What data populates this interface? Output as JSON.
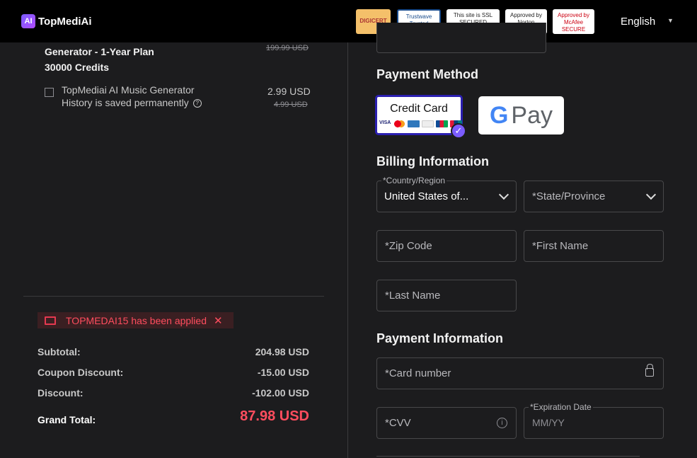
{
  "header": {
    "logo_mark": "AI",
    "logo_text": "TopMediAi",
    "badges": [
      "DIGICERT",
      "Trustwave Trusted Commerce Click to Validate",
      "This site is SSL SECURED",
      "Approved by Norton",
      "Approved by McAfee SECURE"
    ],
    "language": "English"
  },
  "order": {
    "plan_title": "Generator - 1-Year Plan",
    "plan_credits": "30000 Credits",
    "plan_old_price": "199.99 USD",
    "addon_label": "TopMediai AI Music Generator History is saved permanently",
    "addon_price": "2.99 USD",
    "addon_old_price": "4.99 USD",
    "coupon_text": "TOPMEDAI15 has been applied",
    "coupon_close": "✕",
    "subtotal_label": "Subtotal:",
    "subtotal_value": "204.98 USD",
    "coupon_discount_label": "Coupon Discount:",
    "coupon_discount_value": "-15.00 USD",
    "discount_label": "Discount:",
    "discount_value": "-102.00 USD",
    "grand_total_label": "Grand Total:",
    "grand_total_value": "87.98 USD"
  },
  "payment_method": {
    "title": "Payment Method",
    "credit_card_label": "Credit Card",
    "gpay_label": "Pay"
  },
  "billing": {
    "title": "Billing Information",
    "country_label": "*Country/Region",
    "country_value": "United States of...",
    "state_placeholder": "*State/Province",
    "zip_placeholder": "*Zip Code",
    "first_name_placeholder": "*First Name",
    "last_name_placeholder": "*Last Name"
  },
  "payment_info": {
    "title": "Payment Information",
    "card_number_placeholder": "*Card number",
    "cvv_placeholder": "*CVV",
    "expiration_label": "*Expiration Date",
    "expiration_placeholder": "MM/YY"
  },
  "colors": {
    "accent": "#7b5cff",
    "selected_border": "#2b1fb0",
    "price_red": "#ff4d5e"
  }
}
